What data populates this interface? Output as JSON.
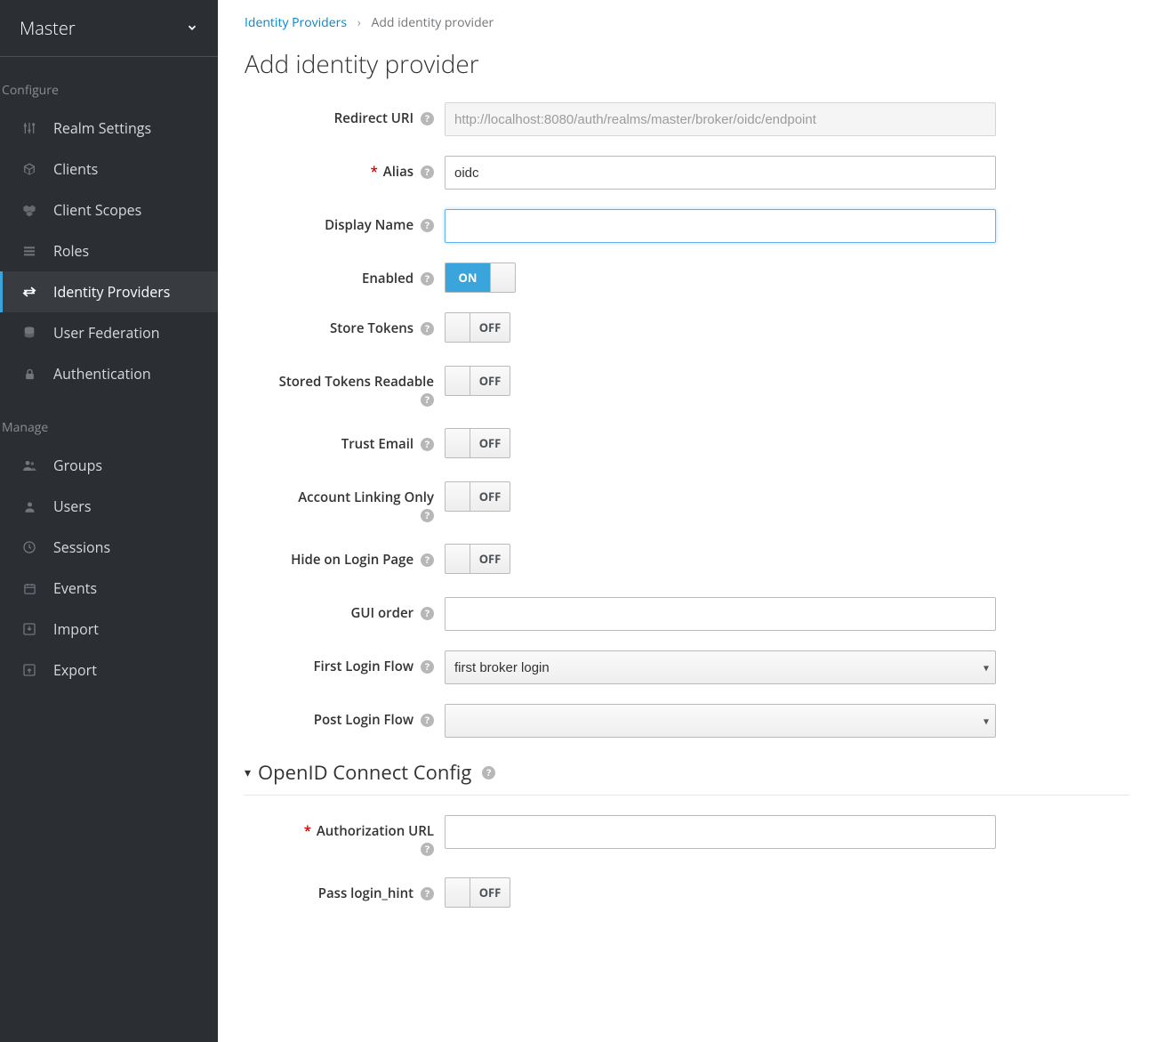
{
  "realm": {
    "name": "Master"
  },
  "sidebar": {
    "sections": [
      {
        "title": "Configure",
        "items": [
          {
            "icon": "sliders-icon",
            "label": "Realm Settings",
            "active": false
          },
          {
            "icon": "cube-icon",
            "label": "Clients",
            "active": false
          },
          {
            "icon": "cubes-icon",
            "label": "Client Scopes",
            "active": false
          },
          {
            "icon": "list-icon",
            "label": "Roles",
            "active": false
          },
          {
            "icon": "exchange-icon",
            "label": "Identity Providers",
            "active": true
          },
          {
            "icon": "database-icon",
            "label": "User Federation",
            "active": false
          },
          {
            "icon": "lock-icon",
            "label": "Authentication",
            "active": false
          }
        ]
      },
      {
        "title": "Manage",
        "items": [
          {
            "icon": "group-icon",
            "label": "Groups",
            "active": false
          },
          {
            "icon": "user-icon",
            "label": "Users",
            "active": false
          },
          {
            "icon": "clock-icon",
            "label": "Sessions",
            "active": false
          },
          {
            "icon": "calendar-icon",
            "label": "Events",
            "active": false
          },
          {
            "icon": "import-icon",
            "label": "Import",
            "active": false
          },
          {
            "icon": "export-icon",
            "label": "Export",
            "active": false
          }
        ]
      }
    ]
  },
  "breadcrumb": {
    "root": "Identity Providers",
    "current": "Add identity provider"
  },
  "page": {
    "title": "Add identity provider"
  },
  "form": {
    "redirect_uri": {
      "label": "Redirect URI",
      "value": "http://localhost:8080/auth/realms/master/broker/oidc/endpoint"
    },
    "alias": {
      "label": "Alias",
      "value": "oidc",
      "required": true
    },
    "display_name": {
      "label": "Display Name",
      "value": ""
    },
    "enabled": {
      "label": "Enabled",
      "value": true,
      "on_text": "ON"
    },
    "store_tokens": {
      "label": "Store Tokens",
      "value": false,
      "off_text": "OFF"
    },
    "stored_tokens_readable": {
      "label": "Stored Tokens Readable",
      "value": false,
      "off_text": "OFF"
    },
    "trust_email": {
      "label": "Trust Email",
      "value": false,
      "off_text": "OFF"
    },
    "account_linking_only": {
      "label": "Account Linking Only",
      "value": false,
      "off_text": "OFF"
    },
    "hide_on_login_page": {
      "label": "Hide on Login Page",
      "value": false,
      "off_text": "OFF"
    },
    "gui_order": {
      "label": "GUI order",
      "value": ""
    },
    "first_login_flow": {
      "label": "First Login Flow",
      "value": "first broker login"
    },
    "post_login_flow": {
      "label": "Post Login Flow",
      "value": ""
    }
  },
  "oidc_section": {
    "title": "OpenID Connect Config",
    "authorization_url": {
      "label": "Authorization URL",
      "value": "",
      "required": true
    },
    "pass_login_hint": {
      "label": "Pass login_hint",
      "value": false,
      "off_text": "OFF"
    }
  }
}
